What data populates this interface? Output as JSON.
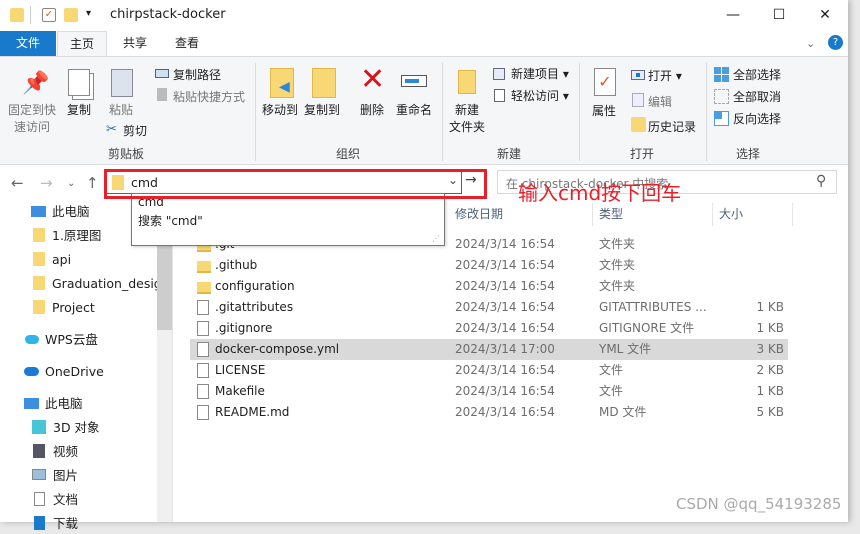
{
  "window": {
    "title": "chirpstack-docker",
    "controls": {
      "minimize": "—",
      "maximize": "☐",
      "close": "✕"
    },
    "help": "?"
  },
  "tabs": [
    {
      "label": "文件"
    },
    {
      "label": "主页"
    },
    {
      "label": "共享"
    },
    {
      "label": "查看"
    }
  ],
  "ribbon": {
    "clipboard": {
      "label": "剪贴板",
      "pin": "固定到快\n速访问",
      "pin1": "固定到快",
      "pin2": "速访问",
      "copy": "复制",
      "paste": "粘贴",
      "copy_path": "复制路径",
      "paste_shortcut": "粘贴快捷方式",
      "cut": "剪切"
    },
    "organize": {
      "label": "组织",
      "move_to": "移动到",
      "copy_to": "复制到",
      "delete": "删除",
      "rename": "重命名"
    },
    "new": {
      "label": "新建",
      "new_folder1": "新建",
      "new_folder2": "文件夹",
      "new_item": "新建项目",
      "easy_access": "轻松访问"
    },
    "open": {
      "label": "打开",
      "properties": "属性",
      "open": "打开",
      "edit": "编辑",
      "history": "历史记录"
    },
    "select": {
      "label": "选择",
      "select_all": "全部选择",
      "select_none": "全部取消",
      "invert": "反向选择"
    }
  },
  "address": {
    "value": "cmd",
    "search_placeholder": "在 chirpstack-docker 中搜索",
    "suggestions": [
      "cmd",
      "搜索 \"cmd\""
    ]
  },
  "annotation": {
    "text": "输入cmd按下回车",
    "color": "#e8202a"
  },
  "sidebar": [
    {
      "label": "此电脑",
      "icon": "computer-icon"
    },
    {
      "label": "1.原理图",
      "icon": "folder-icon"
    },
    {
      "label": "api",
      "icon": "folder-icon"
    },
    {
      "label": "Graduation_desig",
      "icon": "folder-icon"
    },
    {
      "label": "Project",
      "icon": "folder-icon"
    },
    {
      "label": "WPS云盘",
      "icon": "cloud-icon"
    },
    {
      "label": "OneDrive",
      "icon": "cloud-icon"
    },
    {
      "label": "此电脑",
      "icon": "computer-icon"
    },
    {
      "label": "3D 对象",
      "icon": "cube-icon"
    },
    {
      "label": "视频",
      "icon": "video-icon"
    },
    {
      "label": "图片",
      "icon": "picture-icon"
    },
    {
      "label": "文档",
      "icon": "document-icon"
    },
    {
      "label": "下载",
      "icon": "download-icon"
    }
  ],
  "columns": {
    "date": "修改日期",
    "type": "类型",
    "size": "大小"
  },
  "files": [
    {
      "name": ".git",
      "date": "2024/3/14 16:54",
      "type": "文件夹",
      "size": "",
      "folder": true
    },
    {
      "name": ".github",
      "date": "2024/3/14 16:54",
      "type": "文件夹",
      "size": "",
      "folder": true
    },
    {
      "name": "configuration",
      "date": "2024/3/14 16:54",
      "type": "文件夹",
      "size": "",
      "folder": true
    },
    {
      "name": ".gitattributes",
      "date": "2024/3/14 16:54",
      "type": "GITATTRIBUTES ...",
      "size": "1 KB"
    },
    {
      "name": ".gitignore",
      "date": "2024/3/14 16:54",
      "type": "GITIGNORE 文件",
      "size": "1 KB"
    },
    {
      "name": "docker-compose.yml",
      "date": "2024/3/14 17:00",
      "type": "YML 文件",
      "size": "3 KB",
      "selected": true
    },
    {
      "name": "LICENSE",
      "date": "2024/3/14 16:54",
      "type": "文件",
      "size": "2 KB"
    },
    {
      "name": "Makefile",
      "date": "2024/3/14 16:54",
      "type": "文件",
      "size": "1 KB"
    },
    {
      "name": "README.md",
      "date": "2024/3/14 16:54",
      "type": "MD 文件",
      "size": "5 KB"
    }
  ],
  "watermark": "CSDN @qq_54193285"
}
